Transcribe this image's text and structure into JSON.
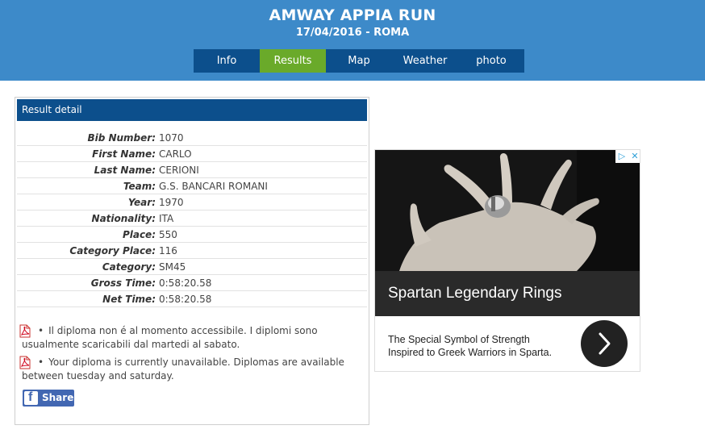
{
  "event": {
    "title": "AMWAY APPIA RUN",
    "subtitle": "17/04/2016 - ROMA"
  },
  "nav": {
    "tabs": [
      {
        "label": "Info",
        "active": false
      },
      {
        "label": "Results",
        "active": true
      },
      {
        "label": "Map",
        "active": false
      },
      {
        "label": "Weather",
        "active": false
      },
      {
        "label": "photo",
        "active": false
      }
    ]
  },
  "result": {
    "heading": "Result detail",
    "rows": [
      {
        "label": "Bib Number:",
        "value": "1070"
      },
      {
        "label": "First Name:",
        "value": "CARLO"
      },
      {
        "label": "Last Name:",
        "value": "CERIONI"
      },
      {
        "label": "Team:",
        "value": "G.S. BANCARI ROMANI"
      },
      {
        "label": "Year:",
        "value": "1970"
      },
      {
        "label": "Nationality:",
        "value": "ITA"
      },
      {
        "label": "Place:",
        "value": "550"
      },
      {
        "label": "Category Place:",
        "value": "116"
      },
      {
        "label": "Category:",
        "value": "SM45"
      },
      {
        "label": "Gross Time:",
        "value": "0:58:20.58"
      },
      {
        "label": "Net Time:",
        "value": "0:58:20.58"
      }
    ]
  },
  "diploma": {
    "it_line1": "Il diploma non é al momento accessibile. I diplomi sono",
    "it_line2": "usualmente scaricabili dal martedi al sabato.",
    "en_line1": "Your diploma is currently unavailable. Diplomas are available",
    "en_line2": "between tuesday and saturday.",
    "icon": "pdf-icon"
  },
  "share": {
    "label": "Share",
    "icon": "facebook-icon"
  },
  "ad": {
    "title": "Spartan Legendary Rings",
    "desc_line1": "The Special Symbol of Strength",
    "desc_line2": "Inspired to Greek Warriors in Sparta.",
    "cta_icon": "chevron-right-icon"
  },
  "colors": {
    "header_bg": "#3d8ac9",
    "nav_bg": "#0c4f8c",
    "active_tab": "#6aaa2a",
    "panel_header": "#0c4f8c",
    "facebook": "#4267b2"
  }
}
